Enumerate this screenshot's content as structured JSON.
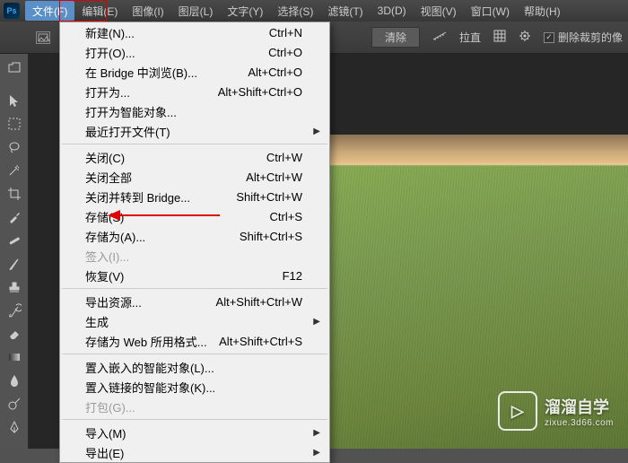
{
  "app": {
    "ps_abbrev": "Ps"
  },
  "menubar": {
    "items": [
      {
        "label": "文件(F)",
        "active": true
      },
      {
        "label": "编辑(E)"
      },
      {
        "label": "图像(I)"
      },
      {
        "label": "图层(L)"
      },
      {
        "label": "文字(Y)"
      },
      {
        "label": "选择(S)"
      },
      {
        "label": "滤镜(T)"
      },
      {
        "label": "3D(D)"
      },
      {
        "label": "视图(V)"
      },
      {
        "label": "窗口(W)"
      },
      {
        "label": "帮助(H)"
      }
    ]
  },
  "optionsbar": {
    "clear": "清除",
    "straighten": "拉直",
    "delete_crop": "删除裁剪的像"
  },
  "file_menu": {
    "groups": [
      [
        {
          "label": "新建(N)...",
          "shortcut": "Ctrl+N"
        },
        {
          "label": "打开(O)...",
          "shortcut": "Ctrl+O"
        },
        {
          "label": "在 Bridge 中浏览(B)...",
          "shortcut": "Alt+Ctrl+O"
        },
        {
          "label": "打开为...",
          "shortcut": "Alt+Shift+Ctrl+O"
        },
        {
          "label": "打开为智能对象..."
        },
        {
          "label": "最近打开文件(T)",
          "submenu": true
        }
      ],
      [
        {
          "label": "关闭(C)",
          "shortcut": "Ctrl+W"
        },
        {
          "label": "关闭全部",
          "shortcut": "Alt+Ctrl+W"
        },
        {
          "label": "关闭并转到 Bridge...",
          "shortcut": "Shift+Ctrl+W"
        },
        {
          "label": "存储(S)",
          "shortcut": "Ctrl+S"
        },
        {
          "label": "存储为(A)...",
          "shortcut": "Shift+Ctrl+S"
        },
        {
          "label": "签入(I)...",
          "disabled": true
        },
        {
          "label": "恢复(V)",
          "shortcut": "F12"
        }
      ],
      [
        {
          "label": "导出资源...",
          "shortcut": "Alt+Shift+Ctrl+W"
        },
        {
          "label": "生成",
          "submenu": true
        },
        {
          "label": "存储为 Web 所用格式...",
          "shortcut": "Alt+Shift+Ctrl+S"
        }
      ],
      [
        {
          "label": "置入嵌入的智能对象(L)..."
        },
        {
          "label": "置入链接的智能对象(K)..."
        },
        {
          "label": "打包(G)...",
          "disabled": true
        }
      ],
      [
        {
          "label": "导入(M)",
          "submenu": true
        },
        {
          "label": "导出(E)",
          "submenu": true
        }
      ]
    ]
  },
  "watermark": {
    "logo_glyph": "▷",
    "title": "溜溜自学",
    "sub": "zixue.3d66.com"
  }
}
